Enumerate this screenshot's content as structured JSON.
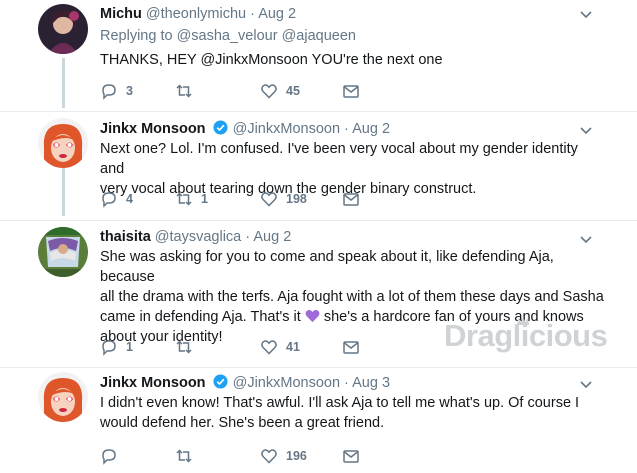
{
  "tweets": [
    {
      "name": "Michu",
      "handle": "@theonlymichu",
      "date": "Aug 2",
      "verified": false,
      "replying_prefix": "Replying to",
      "replying_to": "@sasha_velour @ajaqueen",
      "text": "THANKS, HEY @JinkxMonsoon YOU're the next one",
      "replies": "3",
      "retweets": "",
      "likes": "45"
    },
    {
      "name": "Jinkx Monsoon",
      "handle": "@JinkxMonsoon",
      "date": "Aug 2",
      "verified": true,
      "text_lines": [
        "Next one? Lol. I'm confused. I've been very vocal about my gender identity and",
        "very vocal about tearing down the gender binary construct."
      ],
      "replies": "4",
      "retweets": "1",
      "likes": "198"
    },
    {
      "name": "thaisita",
      "handle": "@taysvaglica",
      "date": "Aug 2",
      "verified": false,
      "text_lines": [
        "She was asking for you to come and speak about it, like defending Aja, because",
        "all the drama with the terfs. Aja fought with a lot of them these days and Sasha",
        "came in defending Aja. That's it",
        "she's a hardcore fan of yours and knows",
        "about your identity!"
      ],
      "replies": "1",
      "retweets": "",
      "likes": "41"
    },
    {
      "name": "Jinkx Monsoon",
      "handle": "@JinkxMonsoon",
      "date": "Aug 3",
      "verified": true,
      "text_lines": [
        "I didn't even know! That's awful. I'll ask Aja to tell me what's up. Of course I",
        "would defend her. She's been a great friend."
      ],
      "replies": "",
      "retweets": "",
      "likes": "196"
    }
  ],
  "separator": "·",
  "watermark": "Draglicious",
  "colors": {
    "verified_blue": "#1da1f2",
    "muted": "#657786",
    "purple_heart": "#a06ad9"
  }
}
